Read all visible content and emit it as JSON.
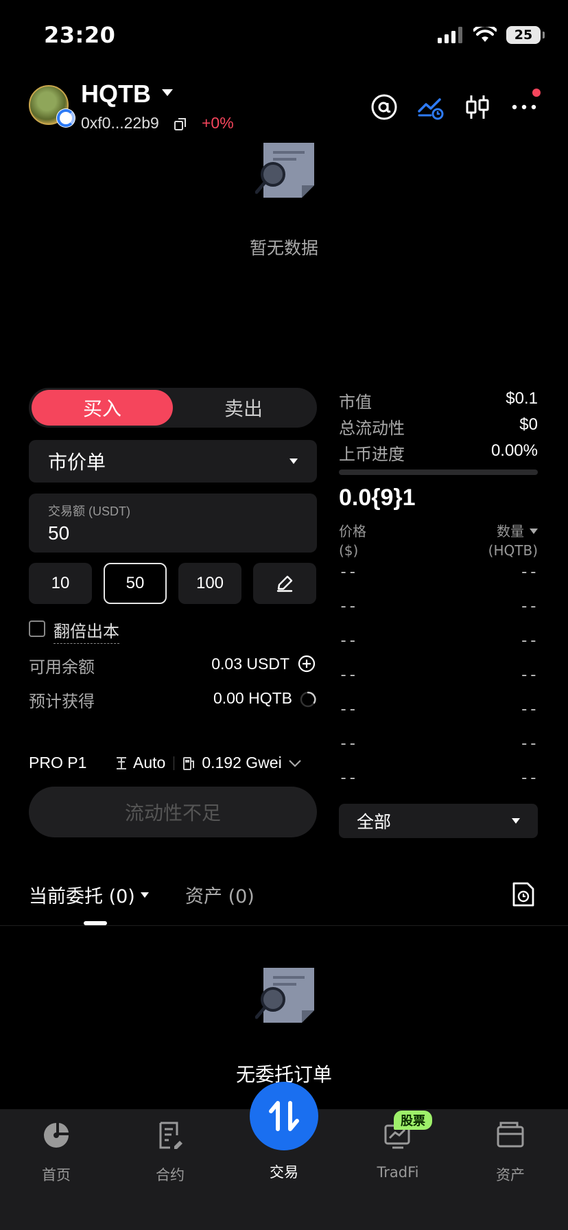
{
  "status_bar": {
    "time": "23:20",
    "battery": "25"
  },
  "header": {
    "token_name": "HQTB",
    "address": "0xf0...22b9",
    "change": "+0%"
  },
  "chart_area": {
    "empty_text": "暂无数据"
  },
  "trade_form": {
    "buy_label": "买入",
    "sell_label": "卖出",
    "order_type": "市价单",
    "amount_label": "交易额 (USDT)",
    "amount_value": "50",
    "presets": [
      "10",
      "50",
      "100"
    ],
    "selected_preset": "50",
    "double_label": "翻倍出本",
    "available_label": "可用余额",
    "available_value": "0.03 USDT",
    "expected_label": "预计获得",
    "expected_value": "0.00 HQTB",
    "pro_label": "PRO P1",
    "slippage": "Auto",
    "gas": "0.192 Gwei",
    "submit_label": "流动性不足"
  },
  "market_info": {
    "stats": [
      {
        "label": "市值",
        "value": "$0.1"
      },
      {
        "label": "总流动性",
        "value": "$0"
      },
      {
        "label": "上币进度",
        "value": "0.00%"
      }
    ],
    "progress_fraction": 0.0,
    "price": "0.0{9}1",
    "price_header": "价格",
    "price_unit": "($)",
    "qty_header": "数量",
    "qty_unit": "(HQTB)",
    "book_rows": [
      [
        "--",
        "--"
      ],
      [
        "--",
        "--"
      ],
      [
        "--",
        "--"
      ],
      [
        "--",
        "--"
      ],
      [
        "--",
        "--"
      ],
      [
        "--",
        "--"
      ],
      [
        "--",
        "--"
      ]
    ],
    "depth_filter": "全部"
  },
  "orders": {
    "tab_current": "当前委托 (0)",
    "tab_assets": "资产 (0)",
    "empty_text": "无委托订单"
  },
  "bottom_nav": {
    "items": [
      {
        "label": "首页",
        "icon": "home-icon"
      },
      {
        "label": "合约",
        "icon": "contract-icon"
      },
      {
        "label": "交易",
        "icon": "trade-icon"
      },
      {
        "label": "TradFi",
        "icon": "tradfi-icon"
      },
      {
        "label": "资产",
        "icon": "wallet-icon"
      }
    ],
    "active": "交易",
    "stock_badge": "股票"
  },
  "colors": {
    "buy": "#f5455c",
    "accent": "#1a6ff0",
    "badge": "#9ef06a"
  }
}
